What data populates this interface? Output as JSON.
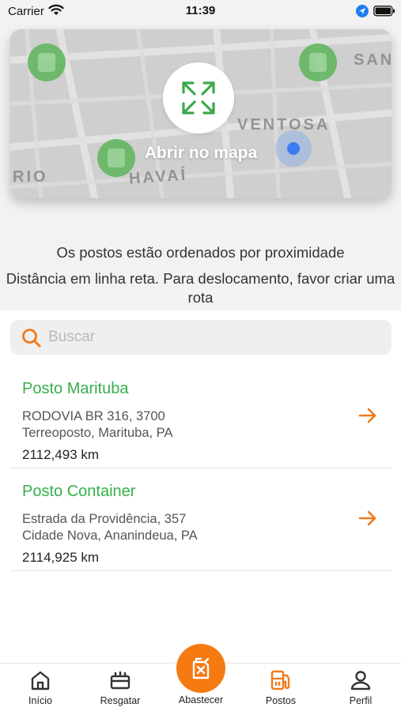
{
  "status_bar": {
    "carrier": "Carrier",
    "time": "11:39",
    "icons": [
      "wifi-icon",
      "location-arrow-icon",
      "battery-icon"
    ]
  },
  "map": {
    "open_label": "Abrir no mapa",
    "street_labels": [
      "VENTOSA",
      "HAVAÍ",
      "RIO",
      "SAN"
    ],
    "expand_icon": "expand-arrows-icon",
    "pin_color": "#5cb55a",
    "user_location_color": "#3a7cf2"
  },
  "info": {
    "line1": "Os postos estão ordenados por proximidade",
    "line2": "Distância em linha reta. Para deslocamento, favor criar uma rota"
  },
  "search": {
    "placeholder": "Buscar",
    "value": "",
    "icon": "search-icon"
  },
  "stations": [
    {
      "name": "Posto Marituba",
      "address_line1": "RODOVIA BR 316, 3700",
      "address_line2": "Terreoposto, Marituba, PA",
      "distance": "2112,493 km"
    },
    {
      "name": "Posto Container",
      "address_line1": "Estrada da Providência, 357",
      "address_line2": "Cidade Nova, Ananindeua, PA",
      "distance": "2114,925 km"
    }
  ],
  "tabs": [
    {
      "label": "Início",
      "icon": "home-icon",
      "active": false
    },
    {
      "label": "Resgatar",
      "icon": "gift-icon",
      "active": false
    },
    {
      "label": "Abastecer",
      "icon": "fuel-can-icon",
      "active": false
    },
    {
      "label": "Postos",
      "icon": "gas-station-icon",
      "active": true
    },
    {
      "label": "Perfil",
      "icon": "user-icon",
      "active": false
    }
  ],
  "colors": {
    "accent": "#f57a12",
    "station_name": "#36b04a",
    "background_grey": "#f2f2f2"
  }
}
